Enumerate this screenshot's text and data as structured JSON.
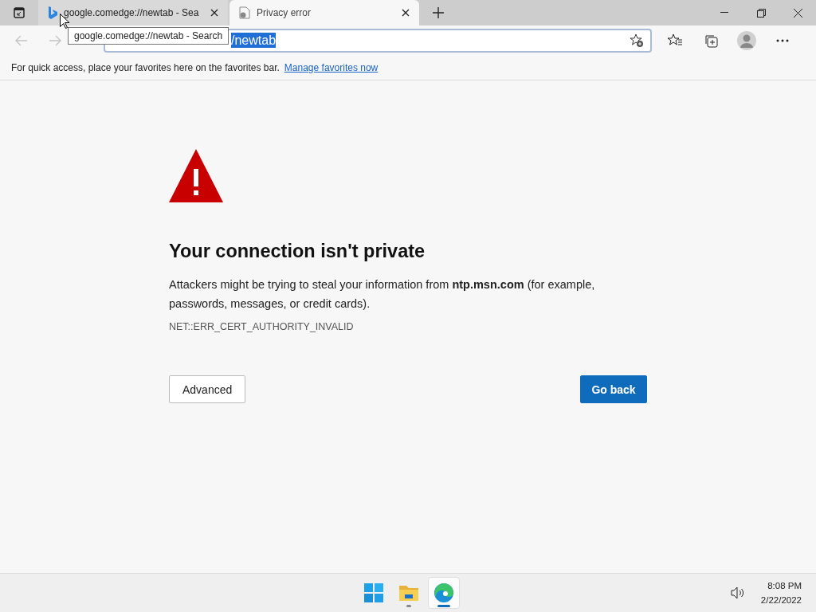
{
  "tabs": [
    {
      "title": "google.comedge://newtab - Sea",
      "selected": false,
      "kind": "bing"
    },
    {
      "title": "Privacy error",
      "selected": true,
      "kind": "page"
    }
  ],
  "tooltip": "google.comedge://newtab - Search",
  "address": {
    "value": "/newtab",
    "selected": true
  },
  "favorites_bar": {
    "text": "For quick access, place your favorites here on the favorites bar.",
    "link": "Manage favorites now"
  },
  "error": {
    "title": "Your connection isn't private",
    "message": "Attackers might be trying to steal your information from **ntp.msn.com** (for example, passwords, messages, or credit cards).",
    "code": "NET::ERR_CERT_AUTHORITY_INVALID",
    "buttons": [
      {
        "label": "Advanced",
        "kind": "secondary"
      },
      {
        "label": "Go back",
        "kind": "primary"
      }
    ]
  },
  "taskbar": {
    "apps": [
      {
        "kind": "start",
        "running": false,
        "selected": false
      },
      {
        "kind": "explorer",
        "running": true,
        "selected": false
      },
      {
        "kind": "edge",
        "running": true,
        "selected": true
      }
    ],
    "time": "8:08 PM",
    "date": "2/22/2022"
  }
}
